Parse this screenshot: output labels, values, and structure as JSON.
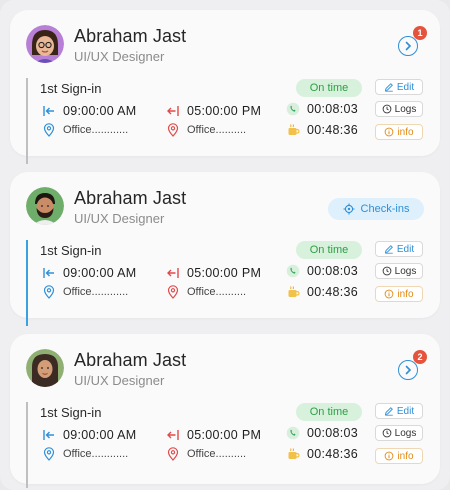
{
  "colors": {
    "accent": "#2f8fd6",
    "exit": "#e04a4a",
    "ontime_bg": "#d8f1dc",
    "ontime_text": "#2d9f45",
    "badge": "#e6533c",
    "info": "#e28a16"
  },
  "cards": [
    {
      "name": "Abraham Jast",
      "role": "UI/UX Designer",
      "badge": "1",
      "signin": "1st Sign-in",
      "status": "On time",
      "checkin_time": "09:00:00 AM",
      "checkout_time": "05:00:00 PM",
      "checkin_location": "Office............",
      "checkout_location": "Office..........",
      "work_duration": "00:08:03",
      "break_duration": "00:48:36",
      "edit_label": "Edit",
      "logs_label": "Logs",
      "info_label": "info"
    },
    {
      "name": "Abraham Jast",
      "role": "UI/UX Designer",
      "checkin_button": "Check-ins",
      "signin": "1st Sign-in",
      "status": "On time",
      "checkin_time": "09:00:00 AM",
      "checkout_time": "05:00:00 PM",
      "checkin_location": "Office............",
      "checkout_location": "Office..........",
      "work_duration": "00:08:03",
      "break_duration": "00:48:36",
      "edit_label": "Edit",
      "logs_label": "Logs",
      "info_label": "info"
    },
    {
      "name": "Abraham Jast",
      "role": "UI/UX Designer",
      "badge": "2",
      "signin": "1st Sign-in",
      "status": "On time",
      "checkin_time": "09:00:00 AM",
      "checkout_time": "05:00:00 PM",
      "checkin_location": "Office............",
      "checkout_location": "Office..........",
      "work_duration": "00:08:03",
      "break_duration": "00:48:36",
      "edit_label": "Edit",
      "logs_label": "Logs",
      "info_label": "info"
    }
  ]
}
